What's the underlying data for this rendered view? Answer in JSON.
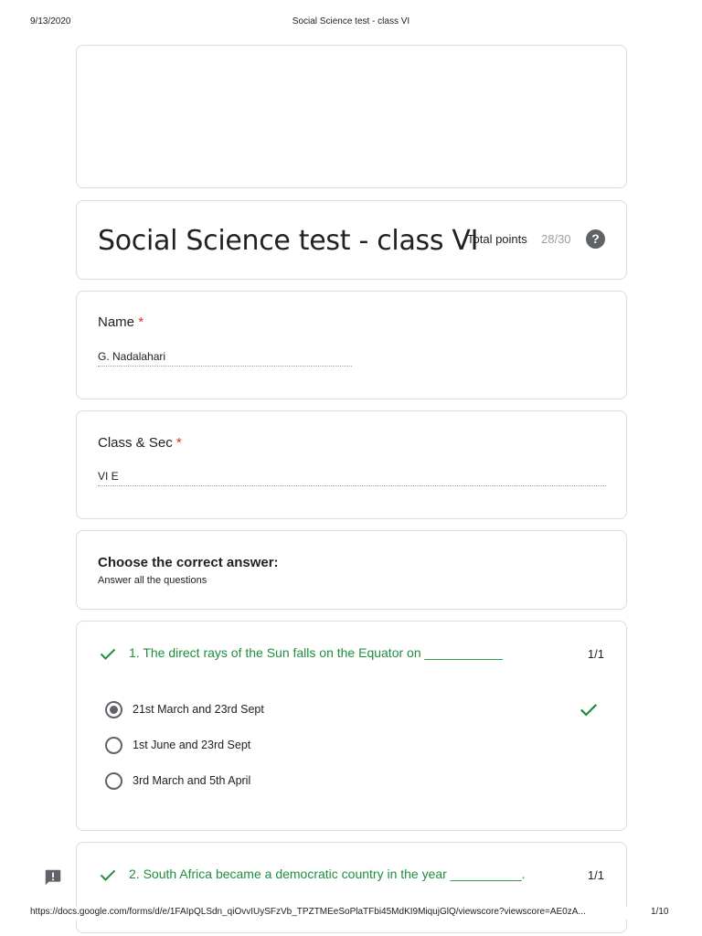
{
  "print_header": {
    "date": "9/13/2020",
    "title": "Social Science test - class VI"
  },
  "form": {
    "title": "Social Science test - class VI",
    "total_points_label": "Total points",
    "total_points_value": "28/30",
    "help_icon": "question-circle-icon"
  },
  "fields": [
    {
      "label": "Name",
      "required": "*",
      "value": "G. Nadalahari"
    },
    {
      "label": "Class & Sec",
      "required": "*",
      "value": "VI E"
    }
  ],
  "section": {
    "title": "Choose the correct answer:",
    "description": "Answer all the questions"
  },
  "questions": [
    {
      "text": "1. The direct rays of the Sun falls on the Equator on ___________",
      "score": "1/1",
      "status_icon": "check-icon",
      "options": [
        {
          "label": "21st March and 23rd Sept",
          "selected": true,
          "correct": true
        },
        {
          "label": "1st June and 23rd Sept",
          "selected": false
        },
        {
          "label": "3rd March and 5th April",
          "selected": false
        }
      ]
    },
    {
      "text": "2. South Africa became a democratic country in the year __________.",
      "score": "1/1",
      "status_icon": "check-icon"
    }
  ],
  "feedback_icon": "report-feedback-icon",
  "print_footer": {
    "url": "https://docs.google.com/forms/d/e/1FAIpQLSdn_qiOvvIUySFzVb_TPZTMEeSoPlaTFbi45MdKI9MiqujGlQ/viewscore?viewscore=AE0zA...",
    "page": "1/10"
  },
  "colors": {
    "correct_green": "#1e8e3e",
    "required_red": "#d93025",
    "border": "#dadce0",
    "muted": "#9aa0a6"
  }
}
